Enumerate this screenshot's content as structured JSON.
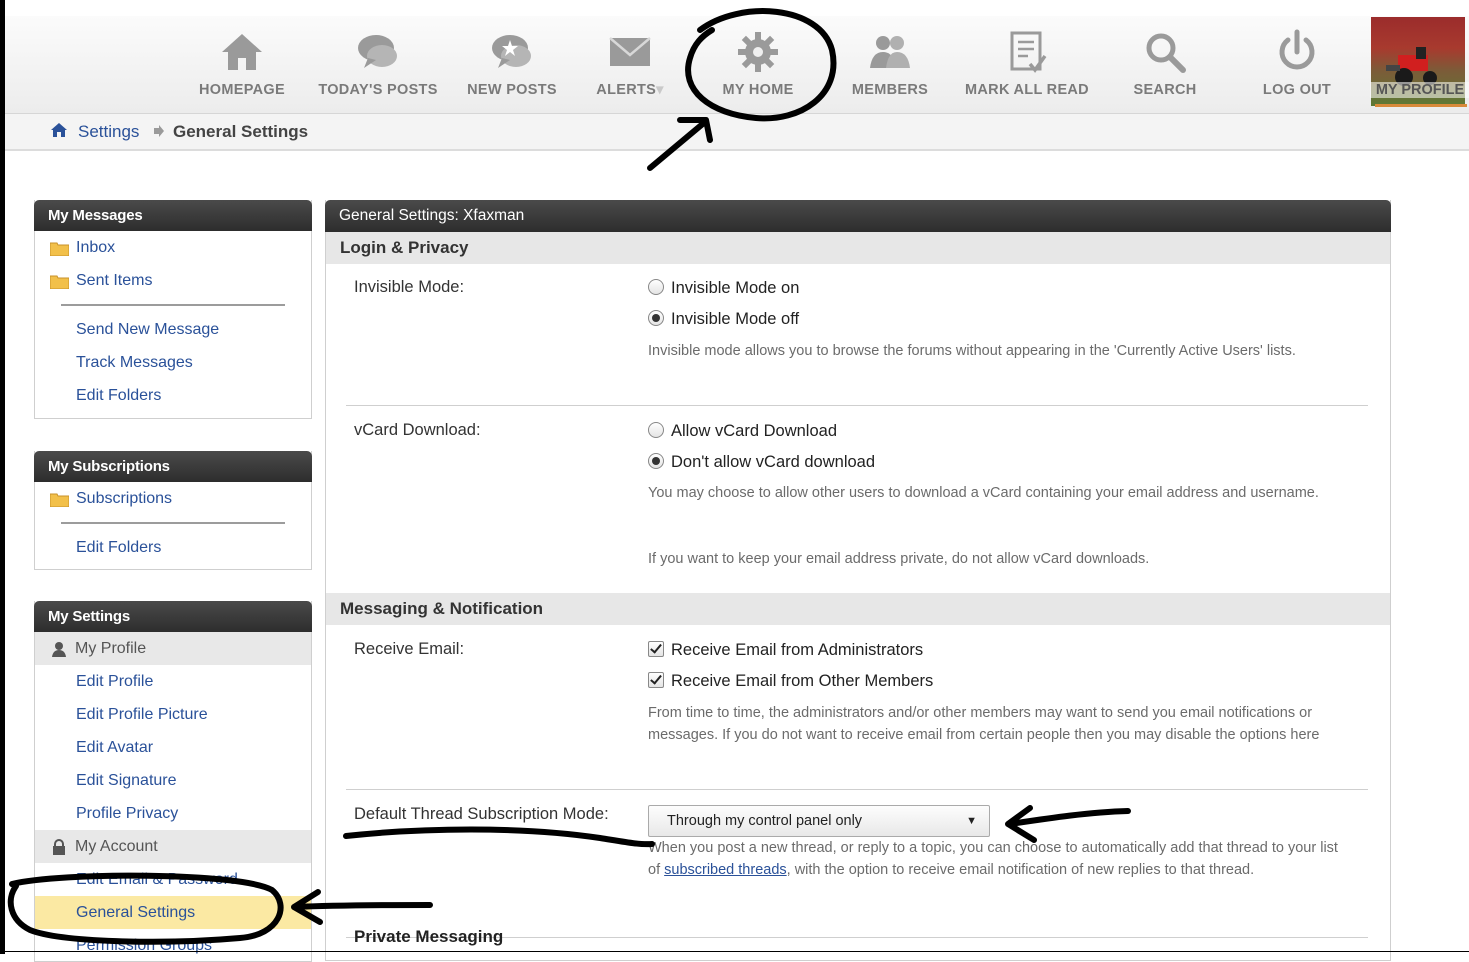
{
  "nav": {
    "items": [
      {
        "label": "HOMEPAGE",
        "icon": "home-icon"
      },
      {
        "label": "TODAY'S POSTS",
        "icon": "chat-bubbles-icon"
      },
      {
        "label": "NEW POSTS",
        "icon": "new-posts-icon"
      },
      {
        "label": "ALERTS",
        "icon": "envelope-icon"
      },
      {
        "label": "MY HOME",
        "icon": "gear-icon"
      },
      {
        "label": "MEMBERS",
        "icon": "members-icon"
      },
      {
        "label": "MARK ALL READ",
        "icon": "mark-read-icon"
      },
      {
        "label": "SEARCH",
        "icon": "search-icon"
      },
      {
        "label": "LOG OUT",
        "icon": "power-icon"
      }
    ],
    "profile_label": "MY PROFILE",
    "alerts_caret": "▾"
  },
  "breadcrumb": {
    "link": "Settings",
    "current": "General Settings"
  },
  "sidebar": {
    "messages": {
      "title": "My Messages",
      "folders": [
        "Inbox",
        "Sent Items"
      ],
      "links": [
        "Send New Message",
        "Track Messages",
        "Edit Folders"
      ]
    },
    "subscriptions": {
      "title": "My Subscriptions",
      "folders": [
        "Subscriptions"
      ],
      "links": [
        "Edit Folders"
      ]
    },
    "settings": {
      "title": "My Settings",
      "profile_header": "My Profile",
      "profile_links": [
        "Edit Profile",
        "Edit Profile Picture",
        "Edit Avatar",
        "Edit Signature",
        "Profile Privacy"
      ],
      "account_header": "My Account",
      "account_links": [
        "Edit Email & Password",
        "General Settings",
        "Permission Groups"
      ]
    }
  },
  "main": {
    "title": "General Settings: Xfaxman",
    "login_privacy": {
      "heading": "Login & Privacy",
      "invisible": {
        "label": "Invisible Mode:",
        "options": [
          "Invisible Mode on",
          "Invisible Mode off"
        ],
        "desc": "Invisible mode allows you to browse the forums without appearing in the 'Currently Active Users' lists."
      },
      "vcard": {
        "label": "vCard Download:",
        "options": [
          "Allow vCard Download",
          "Don't allow vCard download"
        ],
        "desc1": "You may choose to allow other users to download a vCard containing your email address and username.",
        "desc2": "If you want to keep your email address private, do not allow vCard downloads."
      }
    },
    "messaging": {
      "heading": "Messaging & Notification",
      "receive_email": {
        "label": "Receive Email:",
        "options": [
          "Receive Email from Administrators",
          "Receive Email from Other Members"
        ],
        "desc": "From time to time, the administrators and/or other members may want to send you email notifications or messages. If you do not want to receive email from certain people then you may disable the options here"
      },
      "thread_mode": {
        "label": "Default Thread Subscription Mode:",
        "selected": "Through my control panel only",
        "desc_before": "When you post a new thread, or reply to a topic, you can choose to automatically add that thread to your list of ",
        "desc_link": "subscribed threads",
        "desc_after": ", with the option to receive email notification of new replies to that thread."
      }
    },
    "private_messaging_heading": "Private Messaging"
  },
  "colors": {
    "link": "#2a5199",
    "header_dark": "#2d2d2d",
    "active_item": "#fbe9a3",
    "annotation_ink": "#000000"
  }
}
